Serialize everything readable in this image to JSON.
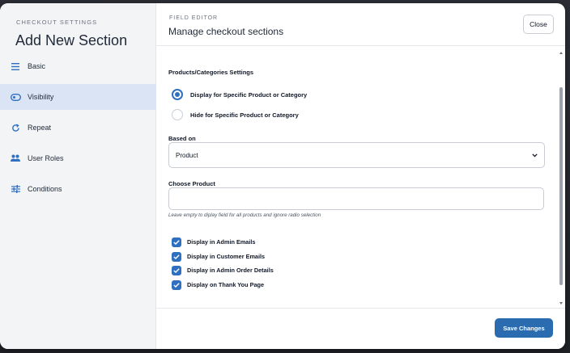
{
  "sidebar": {
    "kicker": "CHECKOUT SETTINGS",
    "title": "Add New Section",
    "items": [
      {
        "label": "Basic",
        "icon": "menu-lines-icon",
        "active": false
      },
      {
        "label": "Visibility",
        "icon": "eye-toggle-icon",
        "active": true
      },
      {
        "label": "Repeat",
        "icon": "repeat-icon",
        "active": false
      },
      {
        "label": "User Roles",
        "icon": "users-icon",
        "active": false
      },
      {
        "label": "Conditions",
        "icon": "sliders-icon",
        "active": false
      }
    ]
  },
  "header": {
    "kicker": "FIELD EDITOR",
    "title": "Manage checkout sections",
    "close_label": "Close"
  },
  "content": {
    "section_heading": "Products/Categories Settings",
    "radios": [
      {
        "label": "Display for Specific Product or Category",
        "checked": true
      },
      {
        "label": "Hide for Specific Product or Category",
        "checked": false
      }
    ],
    "based_on": {
      "label": "Based on",
      "value": "Product"
    },
    "choose_product": {
      "label": "Choose Product",
      "value": "",
      "hint": "Leave empty to diplay field for all products and ignore radio selection"
    },
    "checkboxes": [
      {
        "label": "Display in Admin Emails",
        "checked": true
      },
      {
        "label": "Display in Customer Emails",
        "checked": true
      },
      {
        "label": "Display in Admin Order Details",
        "checked": true
      },
      {
        "label": "Display on Thank You Page",
        "checked": true
      }
    ]
  },
  "footer": {
    "save_label": "Save Changes"
  },
  "colors": {
    "accent": "#2f6fbf",
    "active_nav_bg": "#dbe4f5",
    "save_button": "#2b6cb0"
  }
}
